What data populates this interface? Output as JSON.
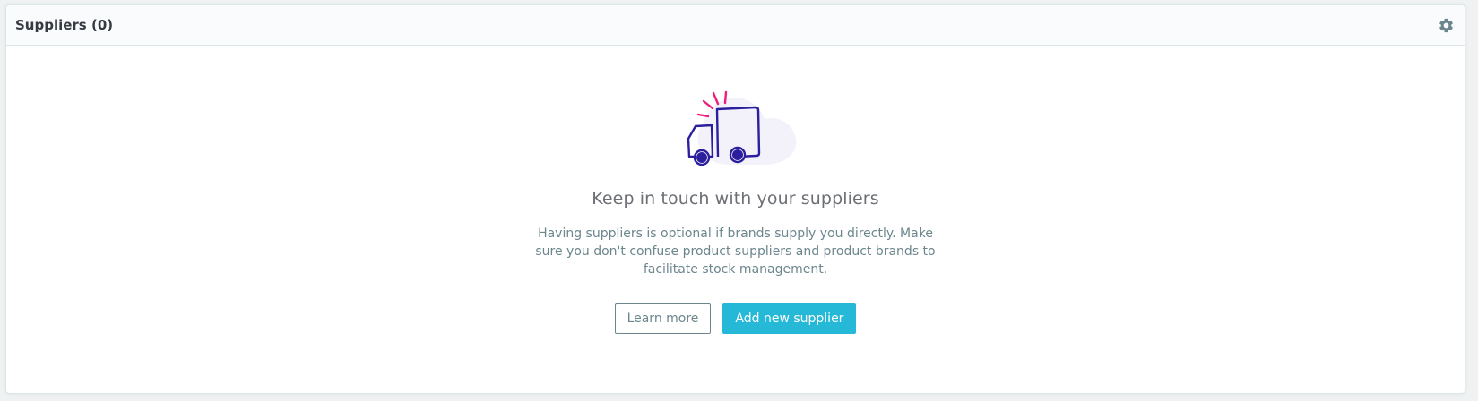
{
  "panel": {
    "title": "Suppliers (0)",
    "settings_icon": "gear-icon"
  },
  "empty_state": {
    "illustration_icon": "delivery-truck-icon",
    "title": "Keep in touch with your suppliers",
    "description": "Having suppliers is optional if brands supply you directly. Make sure you don't confuse product suppliers and product brands to facilitate stock management.",
    "learn_more_label": "Learn more",
    "add_label": "Add new supplier"
  },
  "colors": {
    "primary": "#25b9d7",
    "truck": "#2b1f9e",
    "accent": "#ee1f7a"
  }
}
